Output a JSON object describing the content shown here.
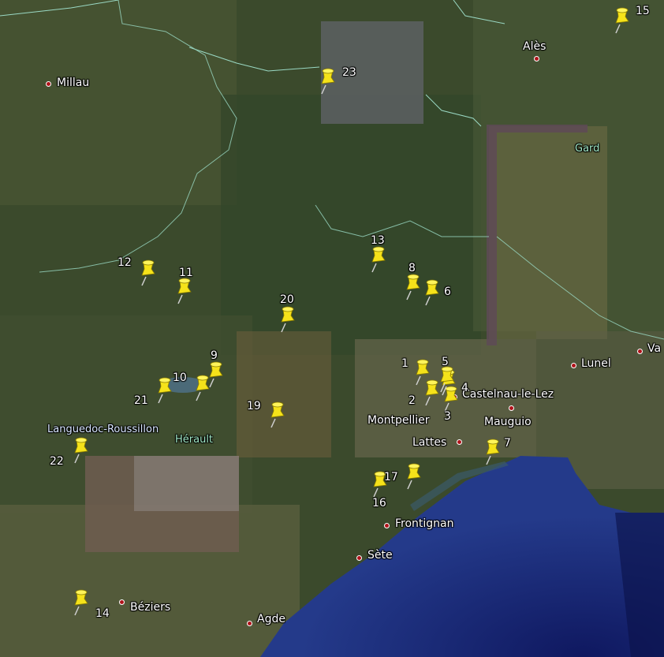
{
  "map": {
    "regions": {
      "languedoc": "Languedoc-Roussillon",
      "herault": "Hérault",
      "gard": "Gard"
    },
    "cities": [
      {
        "name": "Millau"
      },
      {
        "name": "Alès"
      },
      {
        "name": "Lunel"
      },
      {
        "name": "Va"
      },
      {
        "name": "Castelnau-le-Lez"
      },
      {
        "name": "Montpellier"
      },
      {
        "name": "Mauguio"
      },
      {
        "name": "Lattes"
      },
      {
        "name": "Frontignan"
      },
      {
        "name": "Sète"
      },
      {
        "name": "Béziers"
      },
      {
        "name": "Agde"
      }
    ],
    "pins": [
      "1",
      "2",
      "3",
      "4",
      "5",
      "6",
      "7",
      "8",
      "9",
      "10",
      "11",
      "12",
      "13",
      "14",
      "15",
      "16",
      "17",
      "19",
      "20",
      "21",
      "22",
      "23"
    ]
  }
}
